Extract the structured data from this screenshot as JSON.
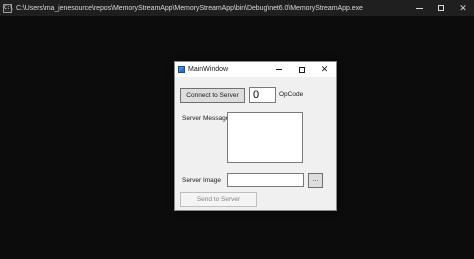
{
  "console": {
    "icon_text": "C:\\",
    "title": "C:\\Users\\ma_jenesource\\repos\\MemoryStreamApp\\MemoryStreamApp\\bin\\Debug\\net6.0\\MemoryStreamApp.exe",
    "minimize_icon": "minimize-icon",
    "maximize_icon": "maximize-icon",
    "close_glyph": "✕"
  },
  "main_window": {
    "title": "MainWindow",
    "close_glyph": "✕",
    "connect_button_label": "Connect to Server",
    "opcode_value": "0",
    "opcode_label": "OpCode",
    "server_message_label": "Server Message",
    "server_message_value": "",
    "server_image_label": "Server Image",
    "server_image_value": "",
    "browse_button_label": "...",
    "send_button_label": "Send to Server",
    "send_button_enabled": false
  }
}
